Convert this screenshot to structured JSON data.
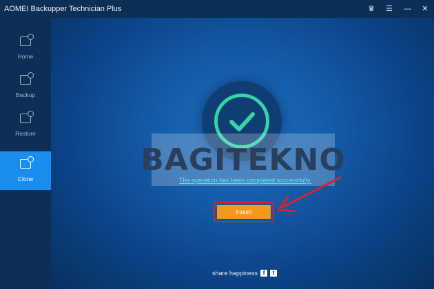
{
  "window": {
    "title": "AOMEI Backupper Technician Plus",
    "controls": [
      "crown-icon",
      "menu-icon",
      "minimize-icon",
      "close-icon"
    ]
  },
  "sidebar": {
    "items": [
      {
        "label": "Home",
        "icon": "home-monitor-icon",
        "active": false
      },
      {
        "label": "Backup",
        "icon": "backup-monitor-icon",
        "active": false
      },
      {
        "label": "Restore",
        "icon": "restore-monitor-icon",
        "active": false
      },
      {
        "label": "Clone",
        "icon": "clone-monitor-icon",
        "active": true
      }
    ]
  },
  "main": {
    "status_icon": "check-circle-icon",
    "watermark": "BAGITEKNO",
    "message": "The operation has been completed successfully.",
    "finish_label": "Finish",
    "share_label": "share happiness",
    "share_icons": [
      "facebook-icon",
      "twitter-icon"
    ]
  },
  "colors": {
    "accent": "#1a8df0",
    "success": "#31d6a8",
    "button": "#f39a1e",
    "annotation": "#d4232d"
  }
}
